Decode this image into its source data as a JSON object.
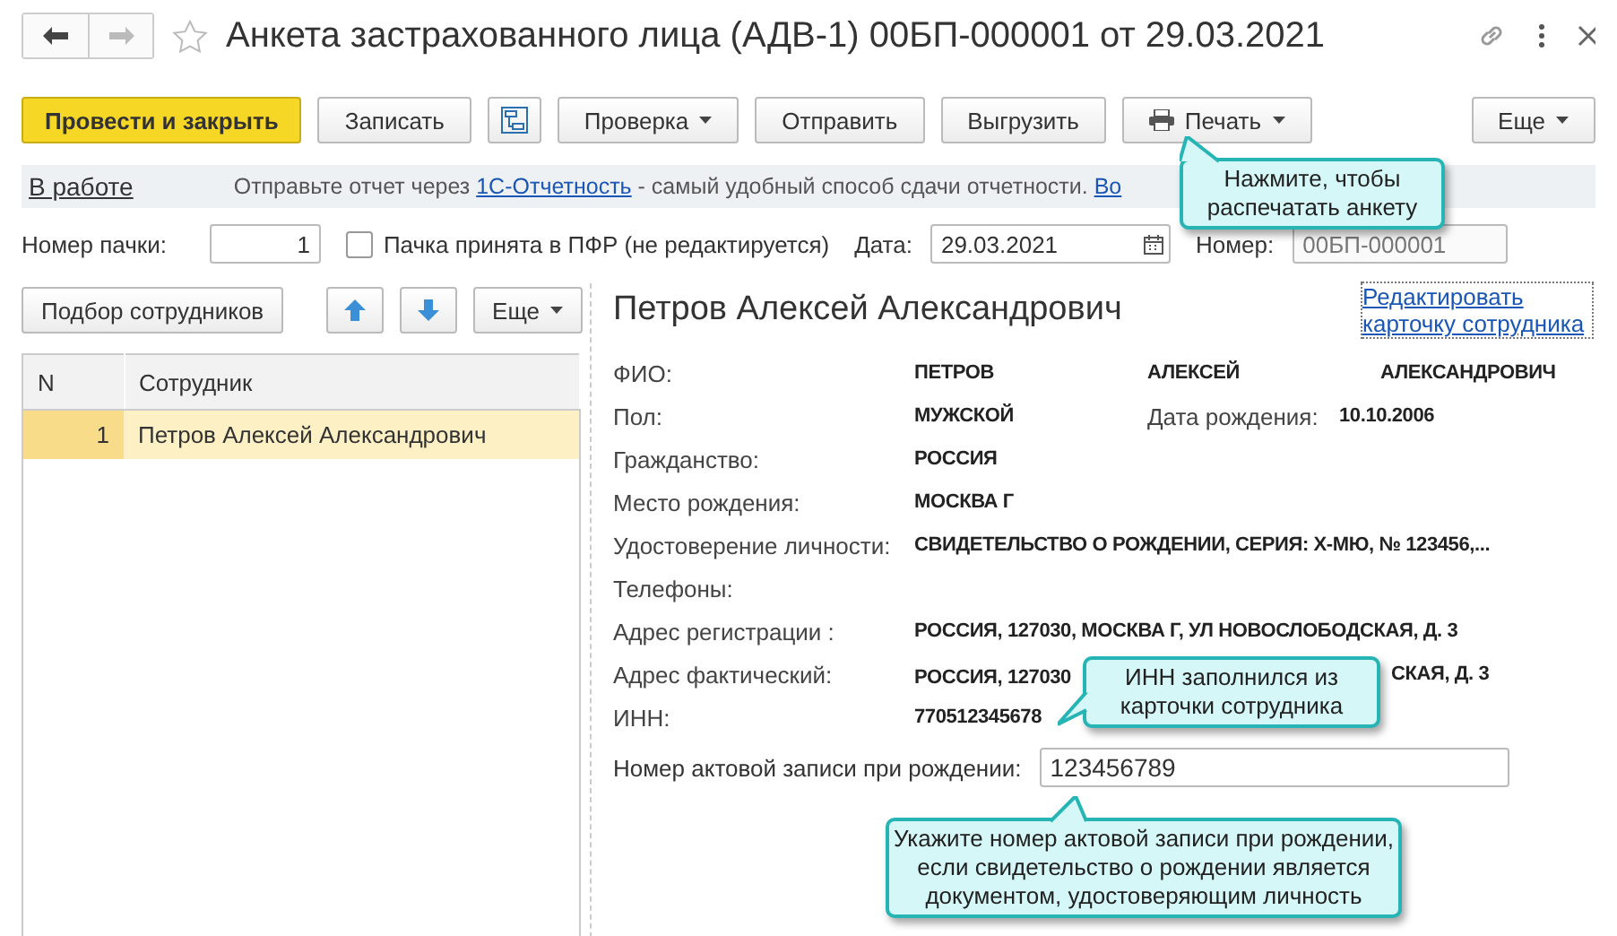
{
  "window": {
    "title": "Анкета застрахованного лица (АДВ-1) 00БП-000001 от 29.03.2021"
  },
  "toolbar": [
    {
      "kind": "primary",
      "label": "Провести и закрыть"
    },
    {
      "kind": "plain",
      "label": "Записать"
    },
    {
      "kind": "structure"
    },
    {
      "kind": "dropdown",
      "label": "Проверка"
    },
    {
      "kind": "plain",
      "label": "Отправить"
    },
    {
      "kind": "plain",
      "label": "Выгрузить"
    },
    {
      "kind": "print",
      "label": "Печать"
    },
    {
      "kind": "more",
      "label": "Еще"
    }
  ],
  "info_bar": {
    "status": "В работе",
    "parts": [
      {
        "kind": "text",
        "text": "Отправьте отчет через "
      },
      {
        "kind": "link",
        "text": "1С-Отчетность"
      },
      {
        "kind": "text",
        "text": " - самый удобный способ сдачи отчетности. "
      },
      {
        "kind": "link",
        "text": "Во"
      }
    ]
  },
  "header_fields": {
    "pack_label": "Номер пачки:",
    "pack_value": "1",
    "accepted": {
      "label": "Пачка принята в ПФР (не редактируется)",
      "checked": false
    },
    "date_label": "Дата:",
    "date_value": "29.03.2021",
    "number_label": "Номер:",
    "number_value": "00БП-000001",
    "number_readonly": true
  },
  "employees": {
    "buttons": [
      {
        "kind": "plain",
        "label": "Подбор сотрудников"
      },
      {
        "kind": "up"
      },
      {
        "kind": "down"
      },
      {
        "kind": "more",
        "label": "Еще"
      }
    ],
    "columns": [
      "N",
      "Сотрудник"
    ],
    "rows": [
      {
        "n": "1",
        "employee": "Петров Алексей Александрович",
        "selected": true
      }
    ]
  },
  "card": {
    "heading": "Петров Алексей Александрович",
    "edit_link": "Редактировать карточку сотрудника",
    "rows": [
      {
        "kind": "triple",
        "label": "ФИО:",
        "values": [
          "ПЕТРОВ",
          "АЛЕКСЕЙ",
          "АЛЕКСАНДРОВИЧ"
        ]
      },
      {
        "kind": "with_date",
        "label": "Пол:",
        "values": [
          "МУЖСКОЙ",
          "Дата рождения:",
          "10.10.2006"
        ]
      },
      {
        "kind": "single",
        "label": "Гражданство:",
        "values": [
          "РОССИЯ"
        ]
      },
      {
        "kind": "single",
        "label": "Место рождения:",
        "values": [
          "МОСКВА Г"
        ]
      },
      {
        "kind": "single",
        "label": "Удостоверение личности:",
        "values": [
          "СВИДЕТЕЛЬСТВО О РОЖДЕНИИ, СЕРИЯ: Х-МЮ, № 123456,..."
        ]
      },
      {
        "kind": "single",
        "label": "Телефоны:",
        "values": []
      },
      {
        "kind": "single",
        "label": "Адрес регистрации :",
        "values": [
          "РОССИЯ, 127030, МОСКВА Г, УЛ НОВОСЛОБОДСКАЯ, Д. 3"
        ]
      },
      {
        "kind": "covered",
        "label": "Адрес фактический:",
        "values": [
          "РОССИЯ, 127030",
          "СКАЯ, Д. 3"
        ]
      },
      {
        "kind": "single",
        "label": "ИНН:",
        "values": [
          "770512345678"
        ]
      }
    ],
    "record_label": "Номер актовой записи при рождении:",
    "record_value": "123456789"
  },
  "callouts": [
    {
      "kind": "print",
      "text": "Нажмите, чтобы распечатать анкету"
    },
    {
      "kind": "inn",
      "text": "ИНН заполнился из карточки сотрудника"
    },
    {
      "kind": "record",
      "text": "Укажите номер актовой записи при рождении, если свидетельство о рождении является документом, удостоверяющим личность"
    }
  ]
}
